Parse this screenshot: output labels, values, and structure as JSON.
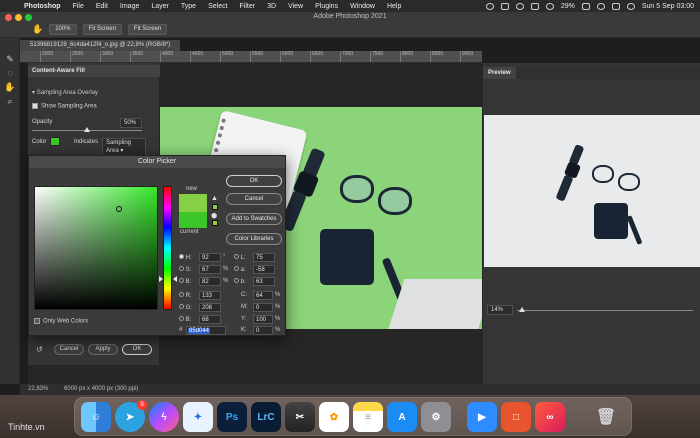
{
  "menubar": {
    "app_name": "Photoshop",
    "items": [
      "File",
      "Edit",
      "Image",
      "Layer",
      "Type",
      "Select",
      "Filter",
      "3D",
      "View",
      "Plugins",
      "Window",
      "Help"
    ],
    "battery": "29%",
    "datetime": "Sun 5 Sep  03:00"
  },
  "window": {
    "title": "Adobe Photoshop 2021"
  },
  "options_bar": {
    "zoom_100": "100%",
    "fit_screen_1": "Fit Screen",
    "fit_screen_2": "Fit Screen"
  },
  "document": {
    "tab_title": "51396819128_6c4da412f4_o.jpg @ 22,8% (RGB/8*)",
    "ruler_ticks": [
      "2000",
      "2500",
      "3000",
      "3500",
      "4000",
      "4500",
      "5000",
      "5500",
      "6000",
      "6500",
      "7000",
      "7500",
      "8000",
      "8500",
      "9000"
    ],
    "zoom_status": "22,83%",
    "size_status": "6000 px x 4000 px (300 ppi)"
  },
  "content_aware_fill": {
    "tab_label": "Content-Aware Fill",
    "section_label": "Sampling Area Overlay",
    "show_sampling_label": "Show Sampling Area",
    "show_sampling_checked": true,
    "opacity_label": "Opacity",
    "opacity_value": "50%",
    "opacity_fraction": 0.5,
    "color_label": "Color",
    "indicates_label": "Indicates",
    "indicates_value": "Sampling Area",
    "cancel_label": "Cancel",
    "apply_label": "Apply",
    "ok_label": "OK"
  },
  "preview": {
    "tab_label": "Preview",
    "zoom_value": "14%"
  },
  "color_picker": {
    "title": "Color Picker",
    "new_label": "new",
    "current_label": "current",
    "new_color": "#85d044",
    "current_color": "#3dc62a",
    "buttons": {
      "ok": "OK",
      "cancel": "Cancel",
      "add_to_swatches": "Add to Swatches",
      "color_libraries": "Color Libraries"
    },
    "hsb": [
      {
        "label": "H:",
        "value": "92",
        "unit": "°",
        "selected": true
      },
      {
        "label": "S:",
        "value": "67",
        "unit": "%",
        "selected": false
      },
      {
        "label": "B:",
        "value": "82",
        "unit": "%",
        "selected": false
      }
    ],
    "rgb": [
      {
        "label": "R:",
        "value": "133"
      },
      {
        "label": "G:",
        "value": "208"
      },
      {
        "label": "B:",
        "value": "68"
      }
    ],
    "lab": [
      {
        "label": "L:",
        "value": "75"
      },
      {
        "label": "a:",
        "value": "-58"
      },
      {
        "label": "b:",
        "value": "63"
      }
    ],
    "cmyk": [
      {
        "label": "C:",
        "value": "64",
        "unit": "%"
      },
      {
        "label": "M:",
        "value": "0",
        "unit": "%"
      },
      {
        "label": "Y:",
        "value": "100",
        "unit": "%"
      },
      {
        "label": "K:",
        "value": "0",
        "unit": "%"
      }
    ],
    "hex_label": "#",
    "hex_value": "85d044",
    "only_web_colors_label": "Only Web Colors"
  },
  "dock": {
    "apps": [
      "Finder",
      "Telegram",
      "Messenger",
      "Safari",
      "Photoshop",
      "Lightroom Classic",
      "Final Cut Pro",
      "Photos",
      "Notes",
      "App Store",
      "System Preferences",
      "Zoom",
      "Office",
      "Creative Cloud",
      "Trash"
    ],
    "telegram_badge": "9",
    "ps_label": "Ps",
    "lrc_label": "LrC"
  },
  "watermark": "Tinhte.vn"
}
